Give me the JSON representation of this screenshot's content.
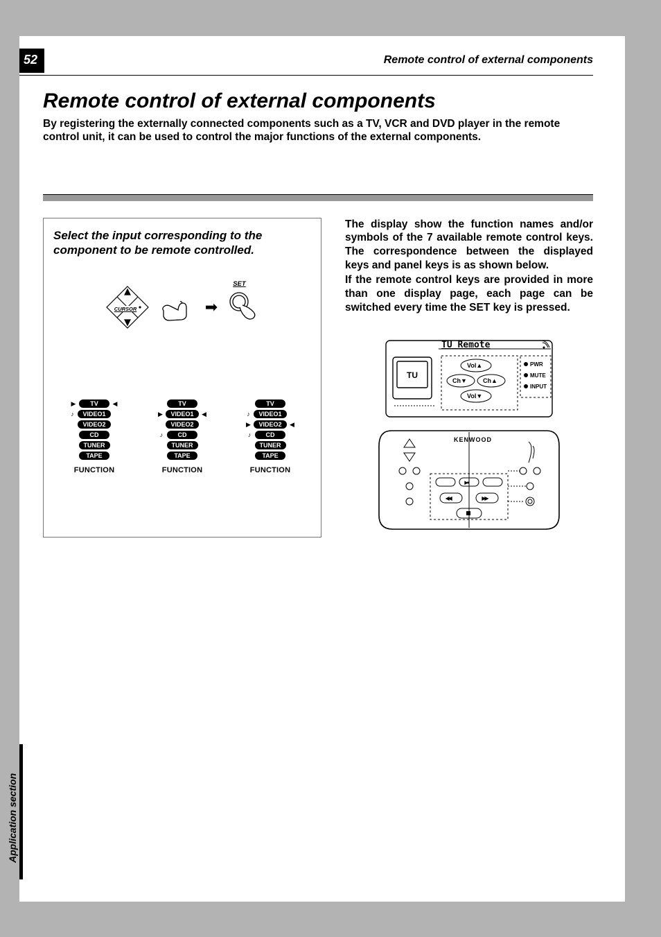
{
  "page_number": "52",
  "header_title": "Remote control of external components",
  "main_title": "Remote control of external components",
  "intro_text": "By registering the externally connected components such as a TV, VCR and DVD player in the remote control unit, it can be used to control the major functions of the external components.",
  "left": {
    "heading": "Select the input corresponding to the component to be remote controlled.",
    "cursor_label": "CURSOR",
    "set_label": "SET",
    "function_caption": "FUNCTION",
    "input_list": [
      "TV",
      "VIDEO1",
      "VIDEO2",
      "CD",
      "TUNER",
      "TAPE"
    ],
    "selections": [
      {
        "selected_index": 0,
        "note_indices": [
          1
        ]
      },
      {
        "selected_index": 1,
        "note_indices": [
          1,
          3
        ]
      },
      {
        "selected_index": 2,
        "note_indices": [
          1,
          3
        ]
      }
    ]
  },
  "right": {
    "p1": "The display show the function names and/or symbols of the 7 available remote control keys. The correspondence between the displayed keys and panel keys is as shown below.",
    "p2": "If the remote control keys are provided in more than one display page, each page can be switched every time the SET key is pressed.",
    "display": {
      "title": "TU Remote",
      "source": "TU",
      "buttons": [
        "Vol▲",
        "Ch▼",
        "Ch▲",
        "Vol▼"
      ],
      "side_dots": [
        "PWR",
        "MUTE",
        "INPUT"
      ]
    },
    "brand": "KENWOOD"
  },
  "side_section_label": "Application section"
}
